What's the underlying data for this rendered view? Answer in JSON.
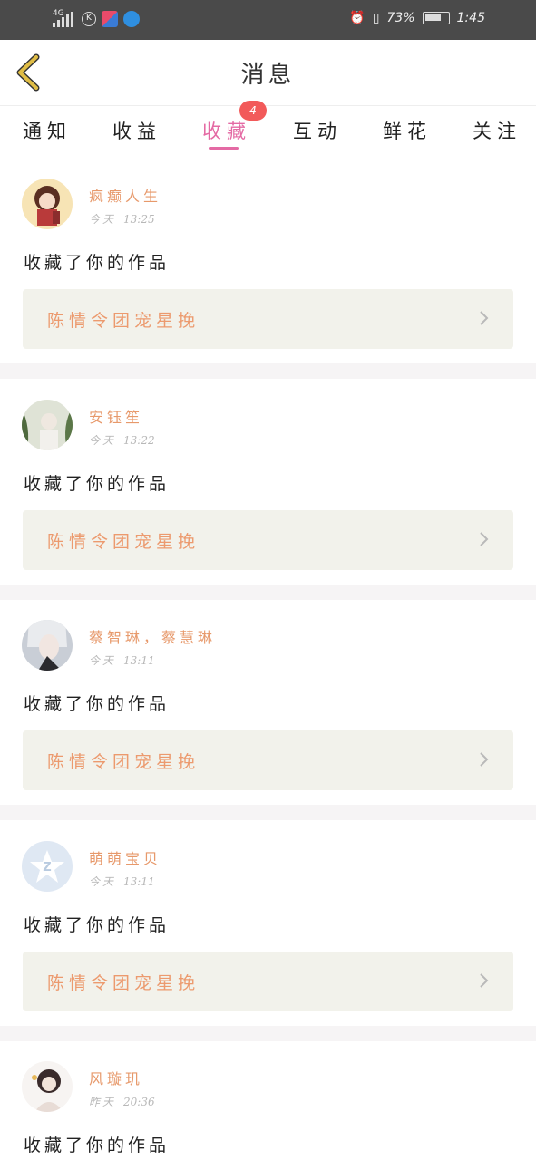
{
  "status_bar": {
    "network": "4G",
    "battery_percent": "73%",
    "time": "1:45"
  },
  "header": {
    "title": "消息"
  },
  "tabs": [
    {
      "label": "通知",
      "active": false
    },
    {
      "label": "收益",
      "active": false
    },
    {
      "label": "收藏",
      "active": true,
      "badge": "4"
    },
    {
      "label": "互动",
      "active": false
    },
    {
      "label": "鲜花",
      "active": false
    },
    {
      "label": "关注",
      "active": false
    }
  ],
  "messages": [
    {
      "user": "疯癫人生",
      "date": "今天",
      "time": "13:25",
      "action": "收藏了你的作品",
      "work": "陈情令团宠星挽"
    },
    {
      "user": "安钰笙",
      "date": "今天",
      "time": "13:22",
      "action": "收藏了你的作品",
      "work": "陈情令团宠星挽"
    },
    {
      "user": "蔡智琳，蔡慧琳",
      "date": "今天",
      "time": "13:11",
      "action": "收藏了你的作品",
      "work": "陈情令团宠星挽"
    },
    {
      "user": "萌萌宝贝",
      "date": "今天",
      "time": "13:11",
      "action": "收藏了你的作品",
      "work": "陈情令团宠星挽"
    },
    {
      "user": "风璇玑",
      "date": "昨天",
      "time": "20:36",
      "action": "收藏了你的作品",
      "work": ""
    }
  ],
  "colors": {
    "accent": "#e46aa4",
    "username": "#e7996b",
    "work_title": "#ec9a6e",
    "badge": "#f25a5a",
    "work_box_bg": "#f2f2eb",
    "back_arrow": "#d9b43a"
  }
}
